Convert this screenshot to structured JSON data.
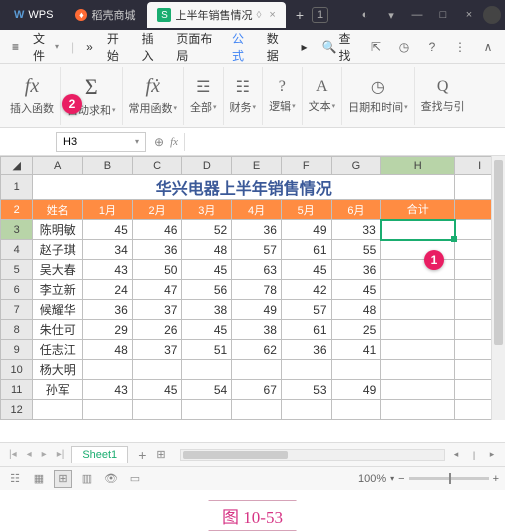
{
  "titlebar": {
    "wps": "WPS",
    "tab_shop": "稻壳商城",
    "tab_doc": "上半年销售情况",
    "add": "+",
    "counter": "1"
  },
  "menubar": {
    "file": "文件",
    "start": "开始",
    "insert": "插入",
    "layout": "页面布局",
    "formula": "公式",
    "data": "数据",
    "search": "查找"
  },
  "ribbon": {
    "insert_fn": "插入函数",
    "auto_sum": "自动求和",
    "common": "常用函数",
    "all": "全部",
    "financial": "财务",
    "logical": "逻辑",
    "text": "文本",
    "datetime": "日期和时间",
    "lookup": "查找与引"
  },
  "namebox": {
    "cell": "H3",
    "fx": "fx"
  },
  "callouts": {
    "c1": "1",
    "c2": "2"
  },
  "sheet": {
    "cols": [
      "A",
      "B",
      "C",
      "D",
      "E",
      "F",
      "G",
      "H",
      "I"
    ],
    "title": "华兴电器上半年销售情况",
    "headers": [
      "姓名",
      "1月",
      "2月",
      "3月",
      "4月",
      "5月",
      "6月",
      "合计"
    ],
    "rows": [
      {
        "n": "3",
        "name": "陈明敏",
        "v": [
          "45",
          "46",
          "52",
          "36",
          "49",
          "33"
        ]
      },
      {
        "n": "4",
        "name": "赵子琪",
        "v": [
          "34",
          "36",
          "48",
          "57",
          "61",
          "55"
        ]
      },
      {
        "n": "5",
        "name": "吴大春",
        "v": [
          "43",
          "50",
          "45",
          "63",
          "45",
          "36"
        ]
      },
      {
        "n": "6",
        "name": "李立新",
        "v": [
          "24",
          "47",
          "56",
          "78",
          "42",
          "45"
        ]
      },
      {
        "n": "7",
        "name": "候耀华",
        "v": [
          "36",
          "37",
          "38",
          "49",
          "57",
          "48"
        ]
      },
      {
        "n": "8",
        "name": "朱仕可",
        "v": [
          "29",
          "26",
          "45",
          "38",
          "61",
          "25"
        ]
      },
      {
        "n": "9",
        "name": "任志江",
        "v": [
          "48",
          "37",
          "51",
          "62",
          "36",
          "41"
        ]
      },
      {
        "n": "10",
        "name": "杨大明",
        "v": [
          "",
          "",
          "",
          "",
          "",
          ""
        ]
      },
      {
        "n": "11",
        "name": "孙军",
        "v": [
          "43",
          "45",
          "54",
          "67",
          "53",
          "49"
        ]
      }
    ],
    "row12": "12"
  },
  "sheettabs": {
    "name": "Sheet1"
  },
  "statusbar": {
    "zoom": "100%"
  },
  "caption": "图 10-53"
}
